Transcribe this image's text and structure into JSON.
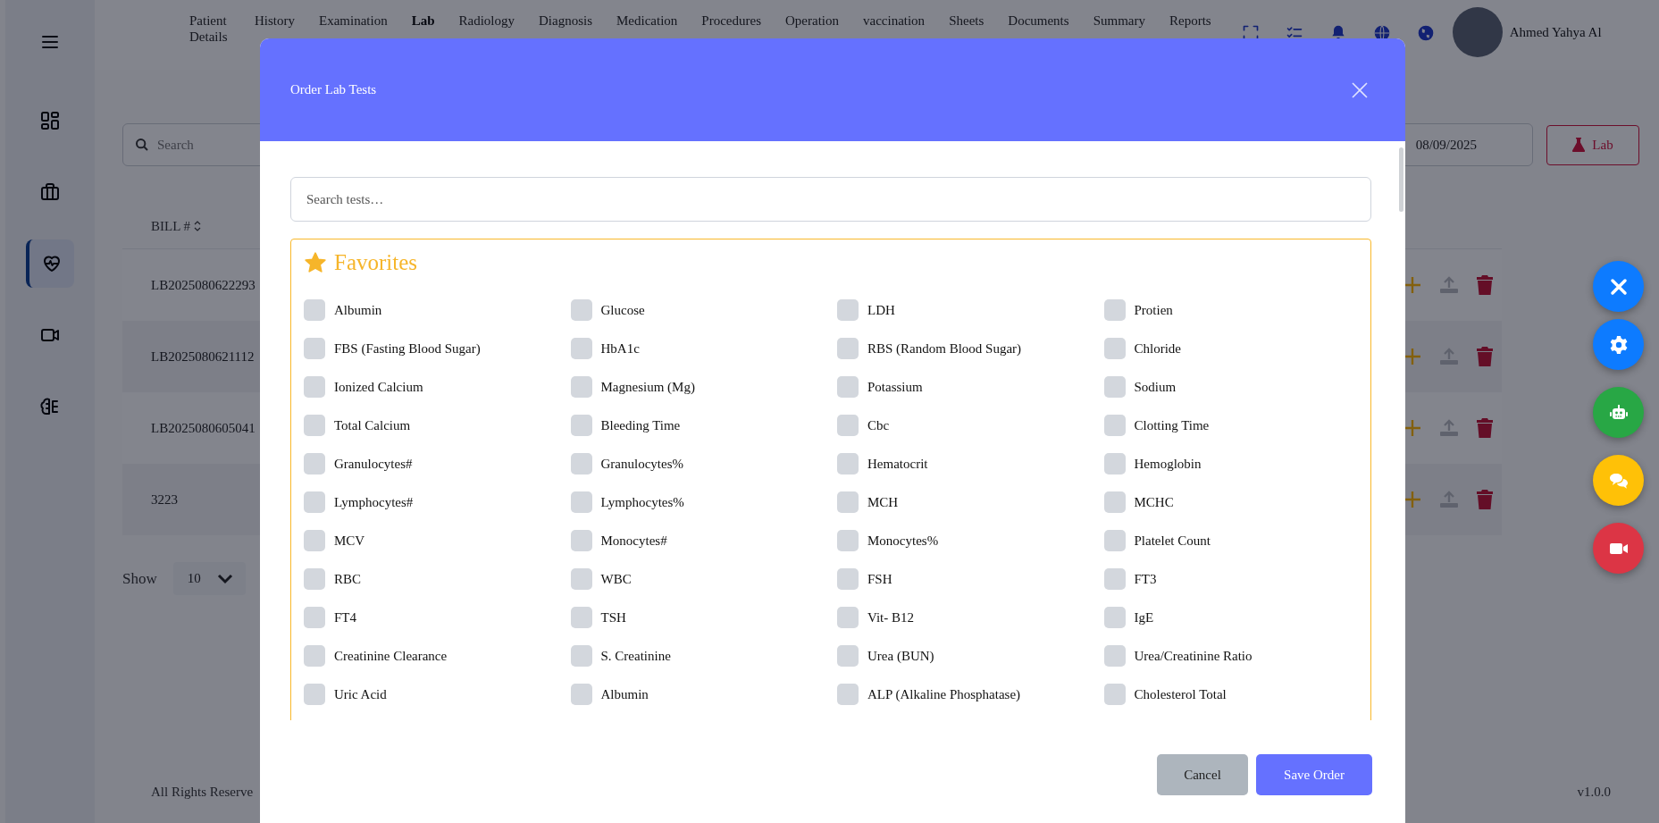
{
  "header": {
    "nav": [
      {
        "label": "Patient Details",
        "selected": false
      },
      {
        "label": "History",
        "selected": false
      },
      {
        "label": "Examination",
        "selected": false
      },
      {
        "label": "Lab",
        "selected": true
      },
      {
        "label": "Radiology",
        "selected": false
      },
      {
        "label": "Diagnosis",
        "selected": false
      },
      {
        "label": "Medication",
        "selected": false
      },
      {
        "label": "Procedures",
        "selected": false
      },
      {
        "label": "Operation",
        "selected": false
      },
      {
        "label": "vaccination",
        "selected": false
      },
      {
        "label": "Sheets",
        "selected": false
      },
      {
        "label": "Documents",
        "selected": false
      },
      {
        "label": "Summary",
        "selected": false
      },
      {
        "label": "Reports",
        "selected": false
      }
    ],
    "user": {
      "name": "Ahmed Yahya Al"
    }
  },
  "sidebar": {
    "items": [
      {
        "kind": "dashboard",
        "selected": false
      },
      {
        "kind": "briefcase",
        "selected": false
      },
      {
        "kind": "heart",
        "selected": true
      },
      {
        "kind": "video",
        "selected": false
      },
      {
        "kind": "brain",
        "selected": false
      }
    ]
  },
  "toolbar": {
    "search": {
      "placeholder": "Search"
    },
    "date": {
      "value": "08/09/2025"
    },
    "lab_button": "Lab"
  },
  "table": {
    "columns": [
      "BILL #"
    ],
    "rows": [
      {
        "bill": "LB2025080622293"
      },
      {
        "bill": "LB2025080621112"
      },
      {
        "bill": "LB2025080605041"
      },
      {
        "bill": "3223"
      }
    ]
  },
  "pagination": {
    "label": "Show",
    "page_size": "10"
  },
  "footer": {
    "copyright": "All Rights Reserve",
    "version": "v1.0.0"
  },
  "modal": {
    "title": "Order Lab Tests",
    "search": {
      "placeholder": "Search tests…"
    },
    "favorites": {
      "title": "Favorites",
      "tests": [
        {
          "label": "Albumin",
          "checked": false
        },
        {
          "label": "Glucose",
          "checked": false
        },
        {
          "label": "LDH",
          "checked": false
        },
        {
          "label": "Protien",
          "checked": false
        },
        {
          "label": "FBS (Fasting Blood Sugar)",
          "checked": false
        },
        {
          "label": "HbA1c",
          "checked": false
        },
        {
          "label": "RBS (Random Blood Sugar)",
          "checked": false
        },
        {
          "label": "Chloride",
          "checked": false
        },
        {
          "label": "Ionized Calcium",
          "checked": false
        },
        {
          "label": "Magnesium (Mg)",
          "checked": false
        },
        {
          "label": "Potassium",
          "checked": false
        },
        {
          "label": "Sodium",
          "checked": false
        },
        {
          "label": "Total Calcium",
          "checked": false
        },
        {
          "label": "Bleeding Time",
          "checked": false
        },
        {
          "label": "Cbc",
          "checked": false
        },
        {
          "label": "Clotting Time",
          "checked": false
        },
        {
          "label": "Granulocytes#",
          "checked": false
        },
        {
          "label": "Granulocytes%",
          "checked": false
        },
        {
          "label": "Hematocrit",
          "checked": false
        },
        {
          "label": "Hemoglobin",
          "checked": false
        },
        {
          "label": "Lymphocytes#",
          "checked": false
        },
        {
          "label": "Lymphocytes%",
          "checked": false
        },
        {
          "label": "MCH",
          "checked": false
        },
        {
          "label": "MCHC",
          "checked": false
        },
        {
          "label": "MCV",
          "checked": false
        },
        {
          "label": "Monocytes#",
          "checked": false
        },
        {
          "label": "Monocytes%",
          "checked": false
        },
        {
          "label": "Platelet Count",
          "checked": false
        },
        {
          "label": "RBC",
          "checked": false
        },
        {
          "label": "WBC",
          "checked": false
        },
        {
          "label": "FSH",
          "checked": false
        },
        {
          "label": "FT3",
          "checked": false
        },
        {
          "label": "FT4",
          "checked": false
        },
        {
          "label": "TSH",
          "checked": false
        },
        {
          "label": "Vit- B12",
          "checked": false
        },
        {
          "label": "IgE",
          "checked": false
        },
        {
          "label": "Creatinine Clearance",
          "checked": false
        },
        {
          "label": "S. Creatinine",
          "checked": false
        },
        {
          "label": "Urea (BUN)",
          "checked": false
        },
        {
          "label": "Urea/Creatinine Ratio",
          "checked": false
        },
        {
          "label": "Uric Acid",
          "checked": false
        },
        {
          "label": "Albumin",
          "checked": false
        },
        {
          "label": "ALP (Alkaline Phosphatase)",
          "checked": false
        },
        {
          "label": "Cholesterol Total",
          "checked": false
        }
      ]
    },
    "buttons": [
      {
        "kind": "cancel",
        "label": "Cancel"
      },
      {
        "kind": "save",
        "label": "Save Order"
      }
    ]
  },
  "fabs": [
    {
      "kind": "close"
    },
    {
      "kind": "settings"
    },
    {
      "kind": "robot"
    },
    {
      "kind": "chat"
    },
    {
      "kind": "video"
    }
  ]
}
